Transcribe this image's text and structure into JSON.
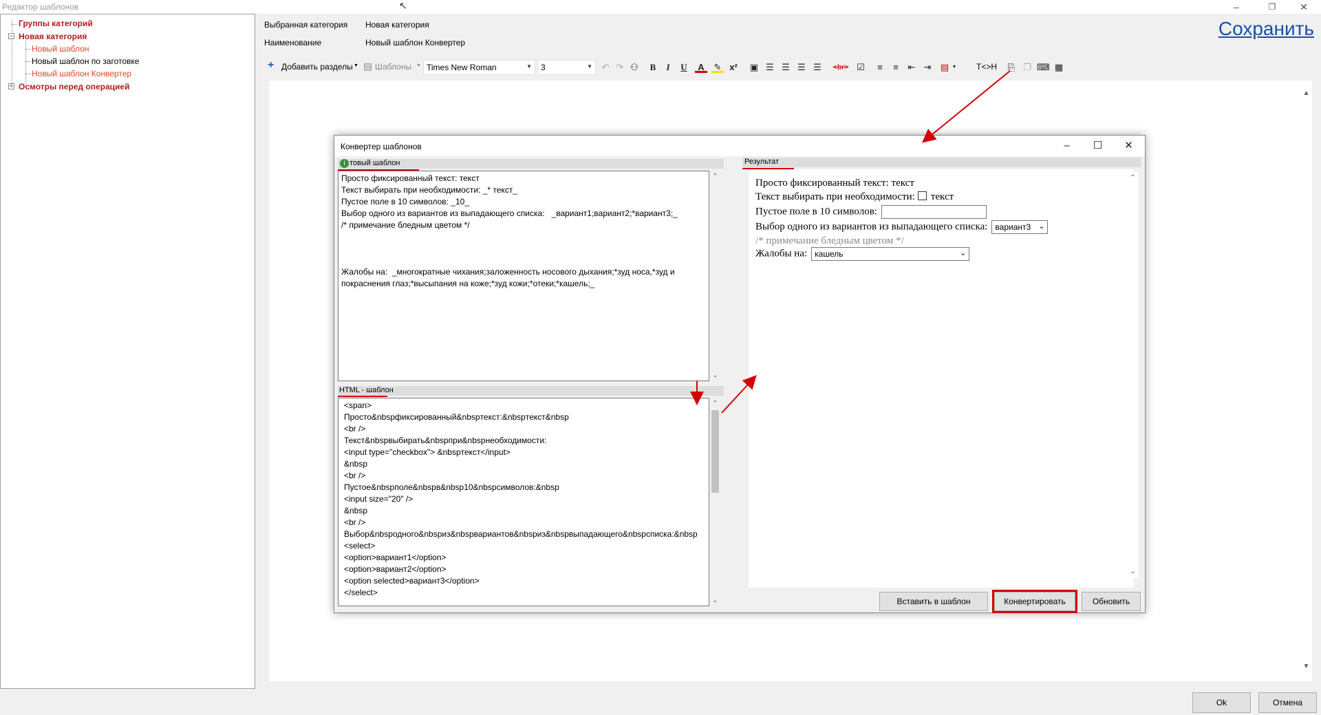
{
  "window": {
    "title": "Редактор шаблонов"
  },
  "tree": {
    "items": [
      {
        "label": "Группы категорий"
      },
      {
        "label": "Новая категория"
      },
      {
        "label": "Новый шаблон"
      },
      {
        "label": "Новый шаблон по заготовке"
      },
      {
        "label": "Новый шаблон Конвертер"
      },
      {
        "label": "Осмотры перед операцией"
      }
    ]
  },
  "header": {
    "category_label": "Выбранная категория",
    "category_value": "Новая категория",
    "name_label": "Наименование",
    "name_value": "Новый шаблон Конвертер",
    "save_link": "Сохранить"
  },
  "toolbar": {
    "add_sections": "Добавить разделы",
    "templates": "Шаблоны",
    "font_family": "Times New Roman",
    "font_size": "3",
    "swap_label": "T<>H"
  },
  "dialog": {
    "title": "Конвертер шаблонов",
    "source_tab": "Новый шаблон",
    "source_tab_visible": "товый шаблон",
    "source_text": "Просто фиксированный текст: текст\nТекст выбирать при необходимости: _* текст_\nПустое поле в 10 символов: _10_\nВыбор одного из вариантов из выпадающего списка:   _вариант1;вариант2;*вариант3;_\n/* примечание бледным цветом */\n\n\n\nЖалобы на:  _многократные чихания;заложенность носового дыхания;*зуд носа,*зуд и покраснения глаз;*высыпания на коже;*зуд кожи;*отеки;*кашель;_",
    "html_tab": "HTML - шаблон",
    "html_text": "<span>\nПросто&nbspфиксированный&nbspтекст:&nbspтекст&nbsp\n<br />\nТекст&nbspвыбирать&nbspпри&nbspнеобходимости:\n<input type=\"checkbox\"> &nbspтекст</input>\n&nbsp\n<br />\nПустое&nbspполе&nbspв&nbsp10&nbspсимволов:&nbsp\n<input size=\"20\" />\n&nbsp\n<br />\nВыбор&nbspодного&nbspиз&nbspвариантов&nbspиз&nbspвыпадающего&nbspсписка:&nbsp\n<select>\n<option>вариант1</option>\n<option>вариант2</option>\n<option selected>вариант3</option>\n</select>",
    "result_tab": "Результат",
    "result": {
      "line1": "Просто фиксированный текст: текст",
      "line2_label": "Текст выбирать при необходимости:",
      "line2_checkbox_text": "текст",
      "line3_label": "Пустое поле в 10 символов:",
      "line4_label": "Выбор одного из вариантов из выпадающего списка:",
      "line4_selected": "вариант3",
      "note": "/* примечание бледным цветом */",
      "complaints_label": "Жалобы на:",
      "complaints_selected": "кашель"
    },
    "buttons": {
      "insert": "Вставить в шаблон",
      "convert": "Конвертировать",
      "refresh": "Обновить"
    }
  },
  "footer": {
    "ok": "Ok",
    "cancel": "Отмена"
  },
  "colors": {
    "category": "#b01e1e",
    "subitem": "#e0442b",
    "link": "#1a4fa8",
    "annotation": "#d40000"
  }
}
